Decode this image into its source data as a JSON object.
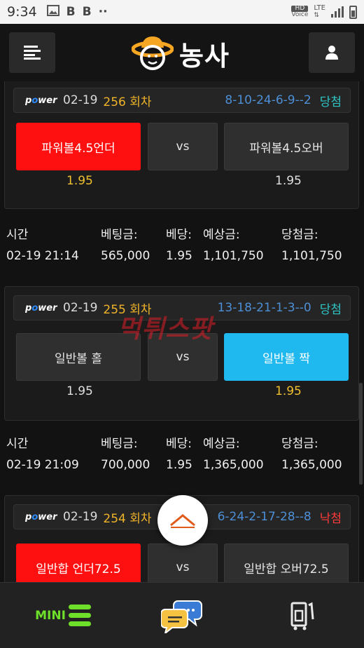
{
  "status_bar": {
    "time": "9:34",
    "icons": [
      "gallery-icon",
      "b-icon",
      "b-icon",
      "more-dots-icon"
    ],
    "network": "LTE",
    "hd": "HD",
    "voice": "Voice"
  },
  "header": {
    "logo_text": "농사",
    "menu_icon": "menu-icon",
    "user_icon": "user-icon"
  },
  "watermark": "먹튀스팟",
  "bets": [
    {
      "brand": "power",
      "date": "02-19",
      "round": "256 회차",
      "result": "8-10-24-6-9--2",
      "status": "당첨",
      "left_label": "파워볼4.5언더",
      "vs": "vs",
      "right_label": "파워볼4.5오버",
      "left_odds": "1.95",
      "right_odds": "1.95",
      "selected": "left"
    },
    {
      "brand": "power",
      "date": "02-19",
      "round": "255 회차",
      "result": "13-18-21-1-3--0",
      "status": "당첨",
      "left_label": "일반볼 홀",
      "vs": "vs",
      "right_label": "일반볼 짝",
      "left_odds": "1.95",
      "right_odds": "1.95",
      "selected": "right"
    },
    {
      "brand": "power",
      "date": "02-19",
      "round": "254 회차",
      "result": "6-24-2-17-28--8",
      "status": "낙첨",
      "left_label": "일반합 언더72.5",
      "vs": "vs",
      "right_label": "일반합 오버72.5",
      "selected": "left"
    }
  ],
  "info_labels": {
    "time": "시간",
    "bet_amount": "베팅금:",
    "odds": "베당:",
    "expected": "예상금:",
    "won": "당첨금:"
  },
  "info_rows": [
    {
      "time": "02-19 21:14",
      "bet_amount": "565,000",
      "odds": "1.95",
      "expected": "1,101,750",
      "won": "1,101,750"
    },
    {
      "time": "02-19 21:09",
      "bet_amount": "700,000",
      "odds": "1.95",
      "expected": "1,365,000",
      "won": "1,365,000"
    }
  ],
  "bottom_nav": {
    "mini_label": "MINI",
    "items": [
      "mini-menu-icon",
      "chat-icon",
      "bet-slip-icon"
    ]
  },
  "colors": {
    "selected_red": "#ff1010",
    "selected_blue": "#1fb8ef",
    "round_gold": "#f0b429",
    "result_blue": "#4d8fd6",
    "win_teal": "#2ec5c5",
    "lose_red": "#ff3a3a",
    "mini_green": "#6ee02a"
  }
}
